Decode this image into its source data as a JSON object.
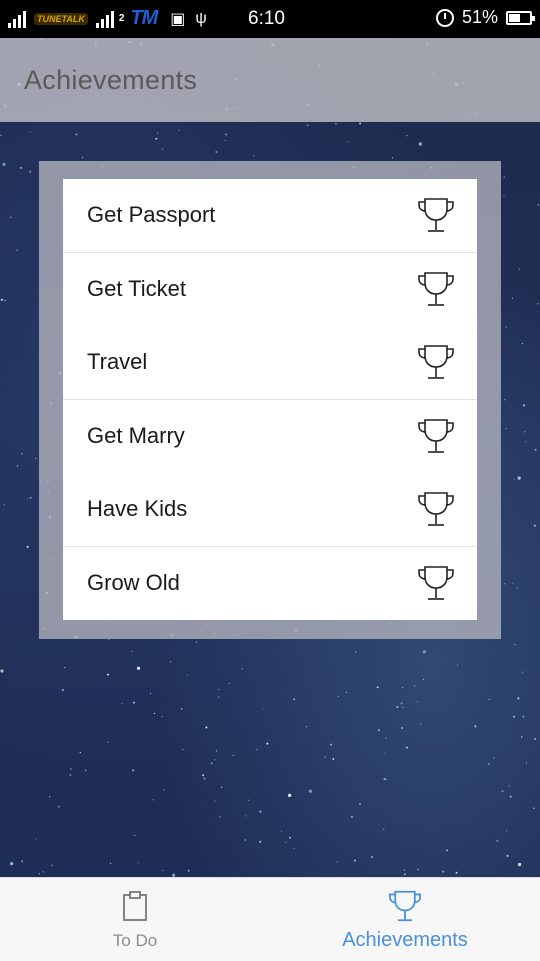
{
  "status_bar": {
    "carrier_1": "TUNETALK",
    "sim_2": "2",
    "carrier_2": "TM",
    "time": "6:10",
    "battery": "51%"
  },
  "app_bar": {
    "title": "Achievements"
  },
  "achievements": [
    {
      "label": "Get Passport",
      "icon": "trophy-icon"
    },
    {
      "label": "Get Ticket",
      "icon": "trophy-icon"
    },
    {
      "label": "Travel",
      "icon": "trophy-icon"
    },
    {
      "label": "Get Marry",
      "icon": "trophy-icon"
    },
    {
      "label": "Have Kids",
      "icon": "trophy-icon"
    },
    {
      "label": "Grow Old",
      "icon": "trophy-icon"
    }
  ],
  "bottom_nav": {
    "tabs": [
      {
        "label": "To Do",
        "icon": "clipboard-icon",
        "active": false
      },
      {
        "label": "Achievements",
        "icon": "trophy-icon",
        "active": true
      }
    ]
  },
  "colors": {
    "accent": "#4a90d9",
    "inactive": "#8e8e8e",
    "appbar": "#bebec4"
  }
}
